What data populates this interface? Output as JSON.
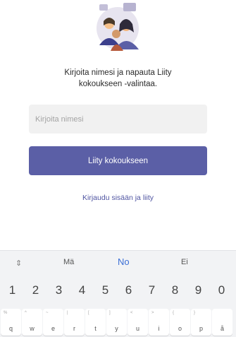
{
  "prompt": {
    "line1": "Kirjoita nimesi ja napauta Liity",
    "line2": "kokoukseen -valintaa."
  },
  "name_input": {
    "placeholder": "Kirjoita nimesi",
    "value": ""
  },
  "join_button": {
    "label": "Liity kokoukseen"
  },
  "signin_link": {
    "label": "Kirjaudu sisään ja liity"
  },
  "colors": {
    "accent": "#5b5fa6",
    "link": "#4f54a1",
    "keyboard_bg": "#f2f3f5"
  },
  "keyboard": {
    "suggestion_icon": "⇕",
    "suggestions": [
      "Mä",
      "No",
      "Ei"
    ],
    "number_row": [
      "1",
      "2",
      "3",
      "4",
      "5",
      "6",
      "7",
      "8",
      "9",
      "0"
    ],
    "letter_row": [
      {
        "alt": "%",
        "main": "q"
      },
      {
        "alt": "^",
        "main": "w"
      },
      {
        "alt": "~",
        "main": "e"
      },
      {
        "alt": "|",
        "main": "r"
      },
      {
        "alt": "[",
        "main": "t"
      },
      {
        "alt": "]",
        "main": "y"
      },
      {
        "alt": "<",
        "main": "u"
      },
      {
        "alt": ">",
        "main": "i"
      },
      {
        "alt": "{",
        "main": "o"
      },
      {
        "alt": "}",
        "main": "p"
      },
      {
        "alt": "",
        "main": "å"
      }
    ]
  }
}
